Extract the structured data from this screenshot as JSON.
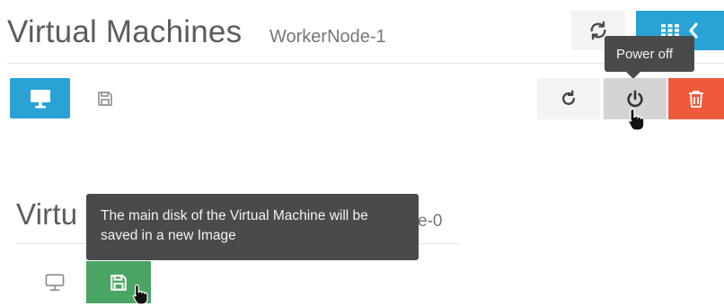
{
  "panel1": {
    "title": "Virtual Machines",
    "subtitle": "WorkerNode-1",
    "tooltip": "Power off",
    "buttons": {
      "console": "monitor-icon",
      "save": "floppy-disk-icon",
      "reboot": "rotate-cw-icon",
      "power_off": "power-icon",
      "delete": "trash-icon",
      "refresh": "sync-icon",
      "grid": "grid-icon",
      "back": "chevron-left-icon"
    }
  },
  "panel2": {
    "title_visible": "Virtu",
    "subtitle_visible": "e-0",
    "tooltip": "The main disk of the Virtual Machine will be saved in a new Image",
    "buttons": {
      "console": "monitor-icon",
      "save": "floppy-disk-icon"
    }
  },
  "colors": {
    "primary": "#29a3d6",
    "danger": "#ee5b3c",
    "success": "#4aa564",
    "neutral": "#f3f3f3",
    "hover": "#d4d4d4",
    "tooltip_bg": "#4a4a4a"
  }
}
